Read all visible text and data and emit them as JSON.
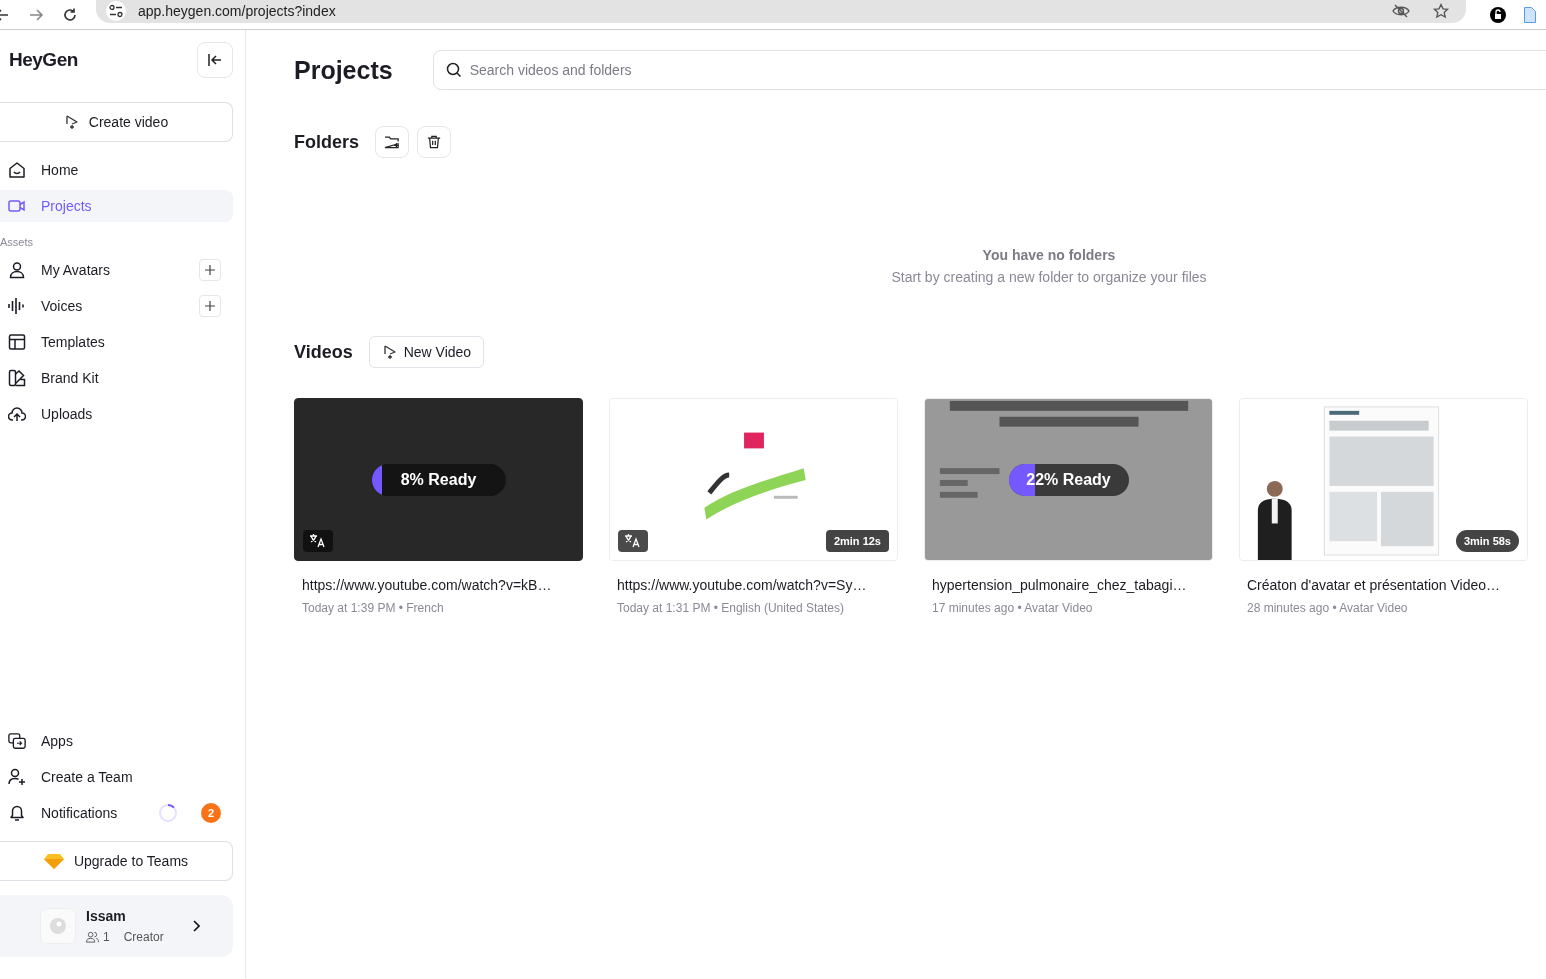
{
  "browser": {
    "url": "app.heygen.com/projects?index"
  },
  "sidebar": {
    "logo": "HeyGen",
    "create_button": "Create video",
    "nav": [
      {
        "label": "Home",
        "selected": false
      },
      {
        "label": "Projects",
        "selected": true
      }
    ],
    "assets_label": "Assets",
    "assets": [
      {
        "label": "My Avatars",
        "selected": false,
        "addable": true
      },
      {
        "label": "Voices",
        "selected": false,
        "addable": true
      },
      {
        "label": "Templates",
        "selected": false,
        "addable": false
      },
      {
        "label": "Brand Kit",
        "selected": false,
        "addable": false
      },
      {
        "label": "Uploads",
        "selected": false,
        "addable": false
      }
    ],
    "bottom": [
      {
        "label": "Apps"
      },
      {
        "label": "Create a Team"
      },
      {
        "label": "Notifications",
        "loading": true,
        "badge": "2"
      }
    ],
    "upgrade_button": "Upgrade to Teams",
    "user": {
      "name": "Issam",
      "members": "1",
      "role": "Creator"
    }
  },
  "main": {
    "title": "Projects",
    "search": {
      "placeholder": "Search videos and folders"
    },
    "folders": {
      "heading": "Folders",
      "empty_title": "You have no folders",
      "empty_subtitle": "Start by creating a new folder to organize your files"
    },
    "videos": {
      "heading": "Videos",
      "new_button": "New Video",
      "items": [
        {
          "title": "https://www.youtube.com/watch?v=kB…",
          "meta": "Today at 1:39 PM • French",
          "kind": "blank",
          "translated": true,
          "progress": {
            "label": "8% Ready",
            "level": 0.08
          }
        },
        {
          "title": "https://www.youtube.com/watch?v=Sy…",
          "meta": "Today at 1:31 PM • English (United States)",
          "kind": "logo",
          "translated": true,
          "duration": {
            "text": "2min 12s",
            "kind": "square"
          }
        },
        {
          "title": "hypertension_pulmonaire_chez_tabagi…",
          "meta": "17 minutes ago • Avatar Video",
          "kind": "slide",
          "translated": false,
          "progress": {
            "label": "22% Ready",
            "level": 0.22
          }
        },
        {
          "title": "Créaton d'avatar et présentation Video…",
          "meta": "28 minutes ago • Avatar Video",
          "kind": "document",
          "translated": false,
          "duration": {
            "text": "3min 58s",
            "kind": "pill"
          }
        }
      ]
    }
  }
}
